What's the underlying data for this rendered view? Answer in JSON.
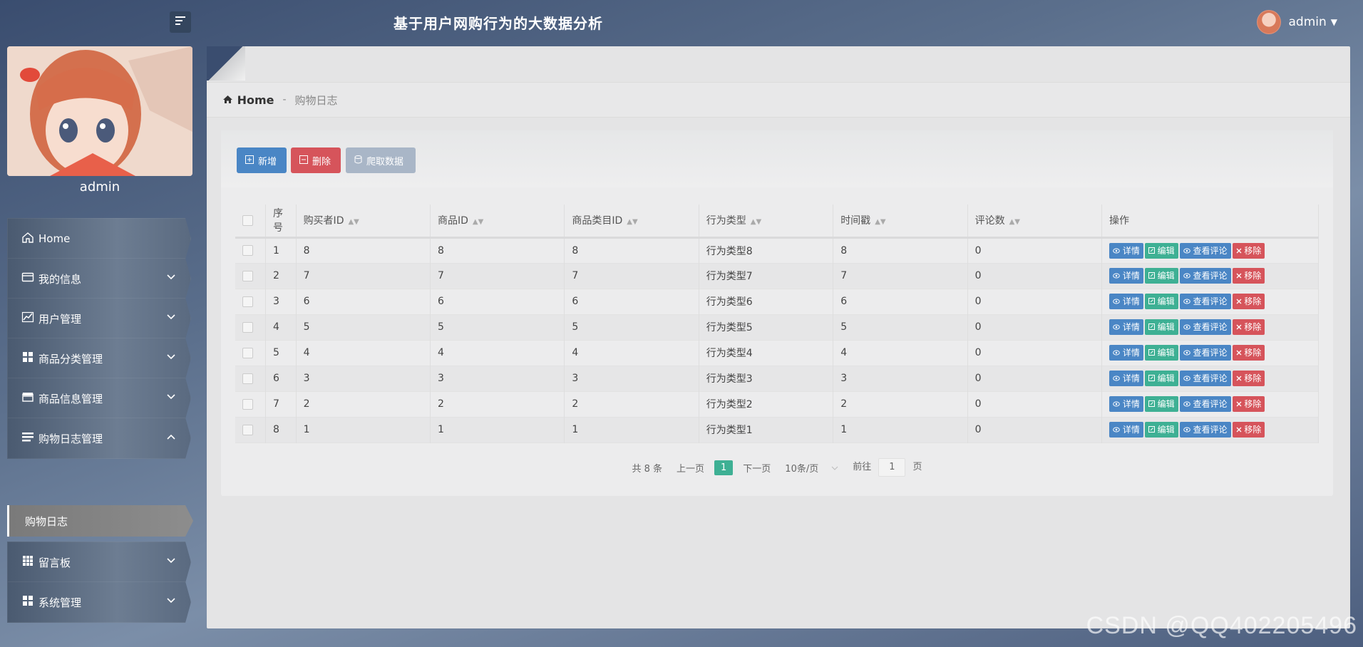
{
  "header": {
    "title": "基于用户网购行为的大数据分析",
    "user_name": "admin"
  },
  "sidebar": {
    "profile_name": "admin",
    "items": [
      {
        "label": "Home",
        "icon": "home-icon"
      },
      {
        "label": "我的信息",
        "icon": "wallet-icon"
      },
      {
        "label": "用户管理",
        "icon": "chart-icon"
      },
      {
        "label": "商品分类管理",
        "icon": "grid-icon"
      },
      {
        "label": "商品信息管理",
        "icon": "store-icon"
      },
      {
        "label": "购物日志管理",
        "icon": "list-icon"
      },
      {
        "label": "留言板",
        "icon": "apps-icon"
      },
      {
        "label": "系统管理",
        "icon": "grid-icon"
      }
    ],
    "sub_item": "购物日志"
  },
  "breadcrumb": {
    "home": "Home",
    "separator": "-",
    "current": "购物日志"
  },
  "toolbar": {
    "add_label": "新增",
    "delete_label": "删除",
    "crawl_label": "爬取数据"
  },
  "table": {
    "columns": [
      "序号",
      "购买者ID",
      "商品ID",
      "商品类目ID",
      "行为类型",
      "时间戳",
      "评论数",
      "操作"
    ],
    "rows": [
      {
        "no": "1",
        "buyer": "8",
        "item": "8",
        "cat": "8",
        "type": "行为类型8",
        "ts": "8",
        "comments": "0"
      },
      {
        "no": "2",
        "buyer": "7",
        "item": "7",
        "cat": "7",
        "type": "行为类型7",
        "ts": "7",
        "comments": "0"
      },
      {
        "no": "3",
        "buyer": "6",
        "item": "6",
        "cat": "6",
        "type": "行为类型6",
        "ts": "6",
        "comments": "0"
      },
      {
        "no": "4",
        "buyer": "5",
        "item": "5",
        "cat": "5",
        "type": "行为类型5",
        "ts": "5",
        "comments": "0"
      },
      {
        "no": "5",
        "buyer": "4",
        "item": "4",
        "cat": "4",
        "type": "行为类型4",
        "ts": "4",
        "comments": "0"
      },
      {
        "no": "6",
        "buyer": "3",
        "item": "3",
        "cat": "3",
        "type": "行为类型3",
        "ts": "3",
        "comments": "0"
      },
      {
        "no": "7",
        "buyer": "2",
        "item": "2",
        "cat": "2",
        "type": "行为类型2",
        "ts": "2",
        "comments": "0"
      },
      {
        "no": "8",
        "buyer": "1",
        "item": "1",
        "cat": "1",
        "type": "行为类型1",
        "ts": "1",
        "comments": "0"
      }
    ],
    "actions": {
      "detail": "详情",
      "edit": "编辑",
      "review": "查看评论",
      "remove": "移除"
    }
  },
  "pagination": {
    "total": "共 8 条",
    "prev": "上一页",
    "current": "1",
    "next": "下一页",
    "page_size": "10条/页",
    "goto_prefix": "前往",
    "goto_value": "1",
    "goto_suffix": "页"
  },
  "watermark": "CSDN @QQ402205496",
  "colors": {
    "primary": "#4a86c5",
    "danger": "#d6545b",
    "success": "#3eb094",
    "disabled": "#a9b6c7"
  }
}
